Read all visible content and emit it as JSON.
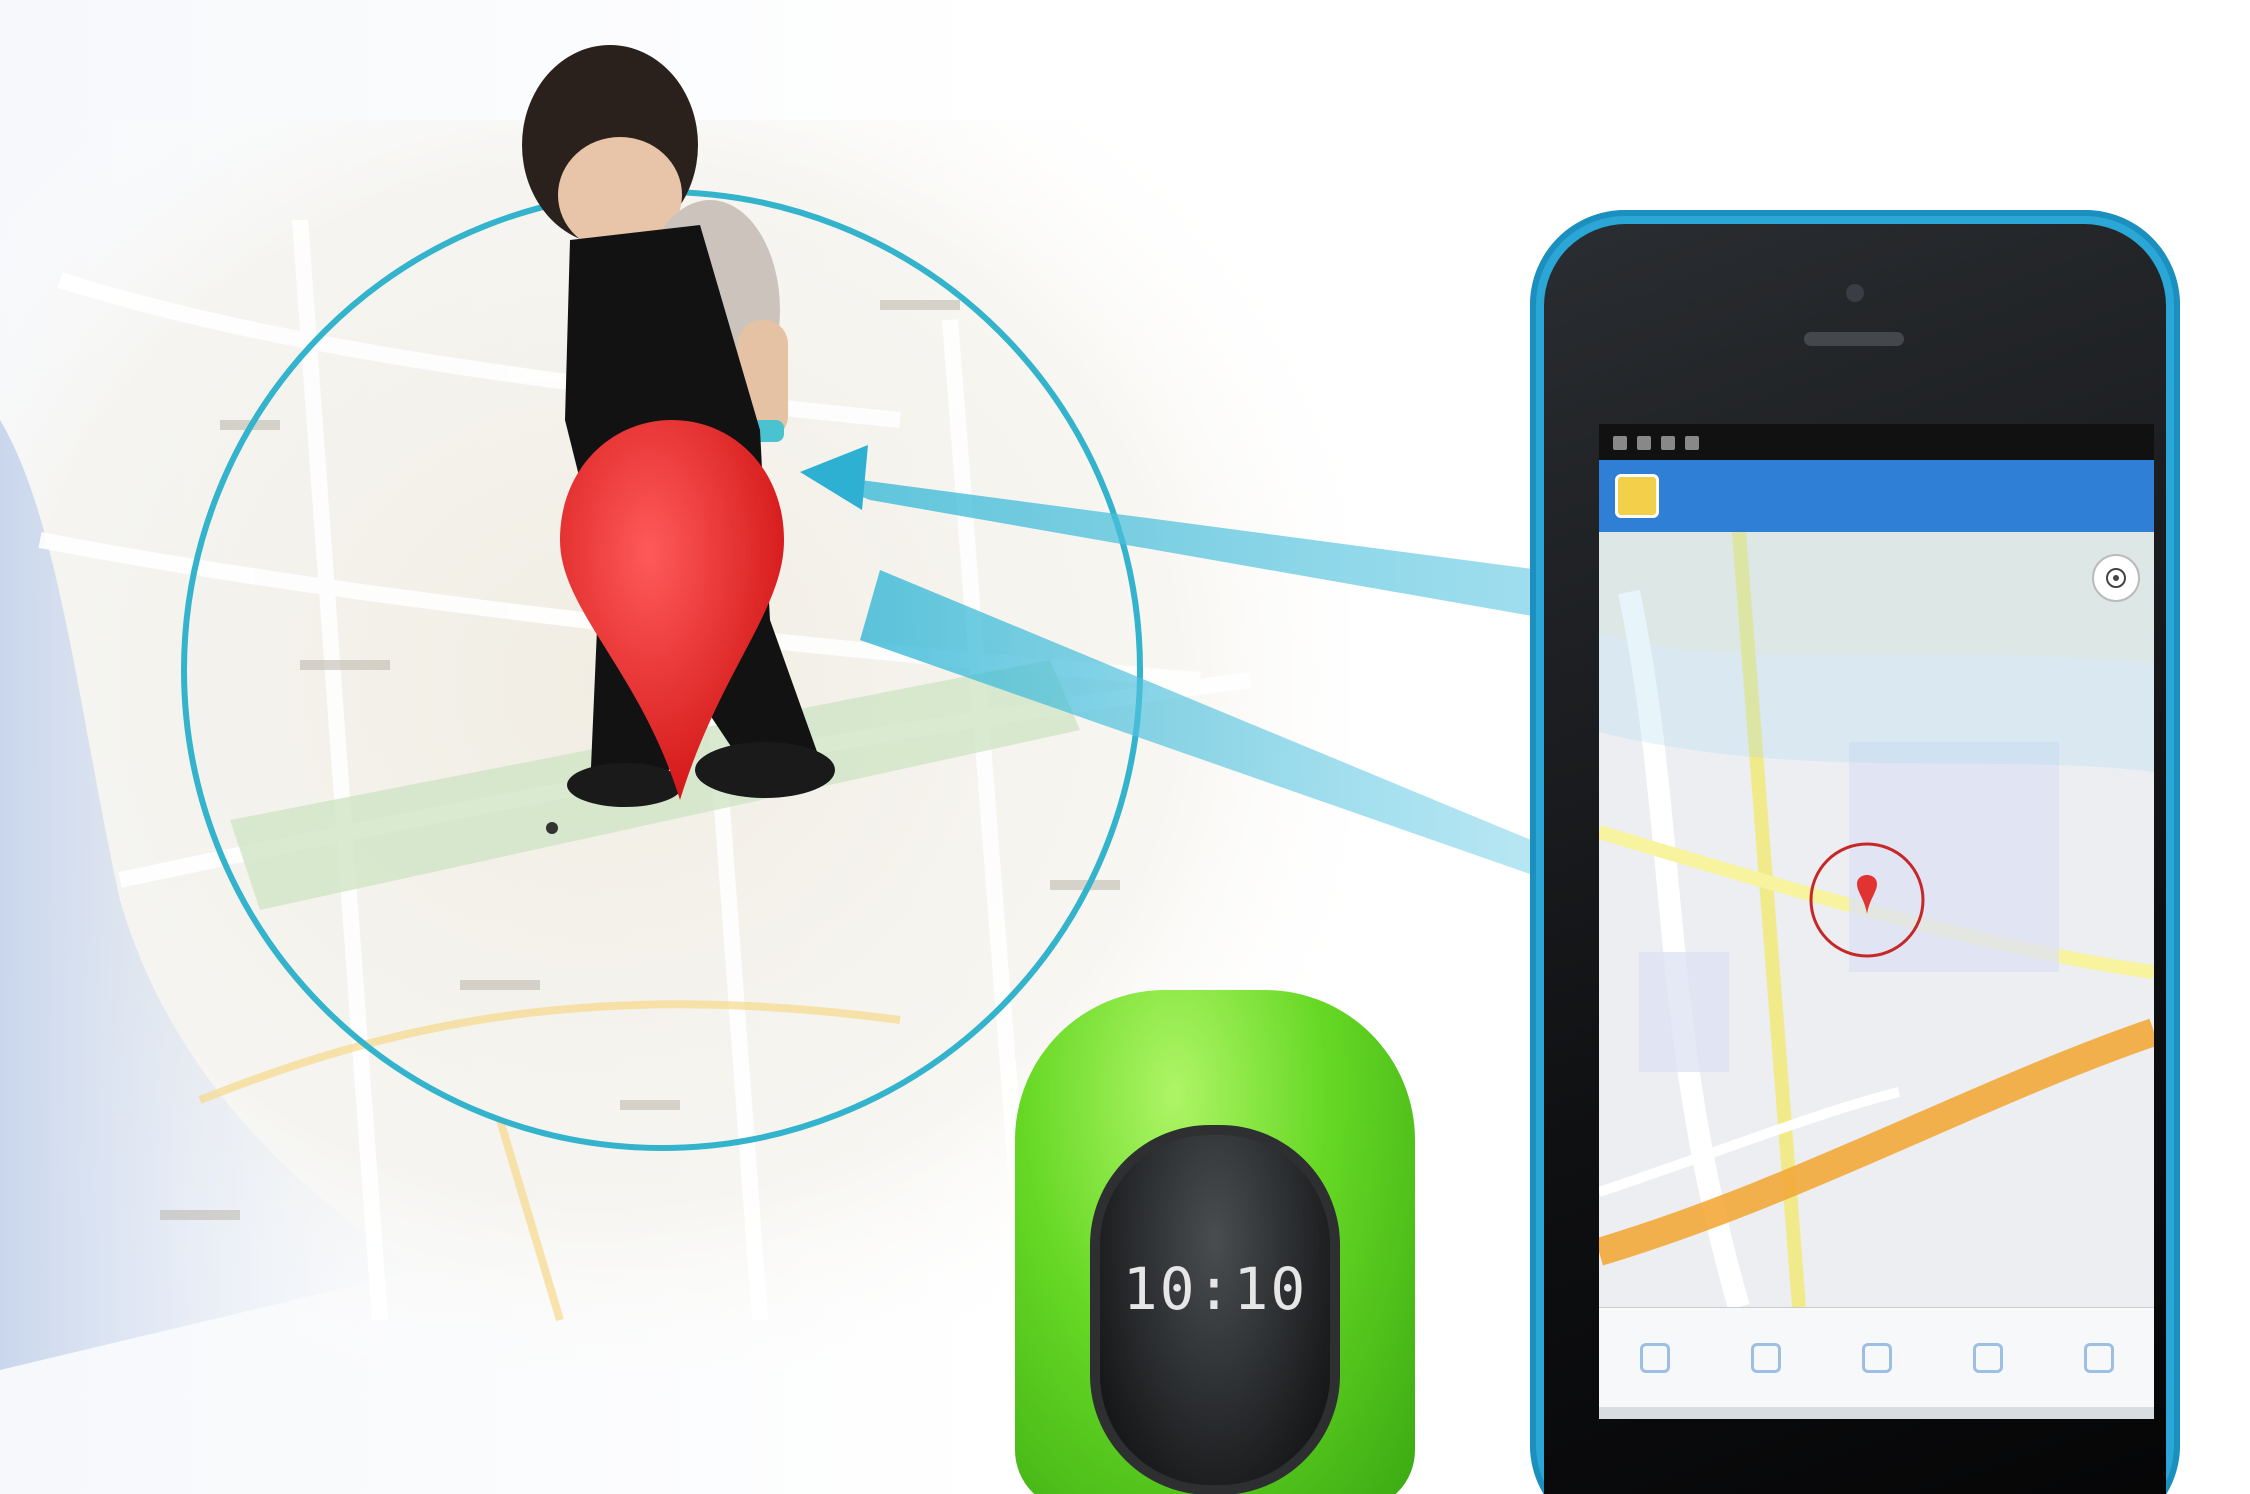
{
  "phone": {
    "app_title": "",
    "app_actions": [
      "",
      ""
    ],
    "status_left": "",
    "status_right": ""
  },
  "watch": {
    "time": "10:10",
    "date": "",
    "status": "",
    "brand": ""
  },
  "colors": {
    "accent": "#2aa7d6",
    "pin": "#e62a2a",
    "geofence": "#33b3cc",
    "watch_green": "#66d824",
    "app_bar": "#2f7fd6"
  },
  "icons": [
    "map-pin-icon",
    "locate-icon",
    "geofence-circle-icon"
  ]
}
